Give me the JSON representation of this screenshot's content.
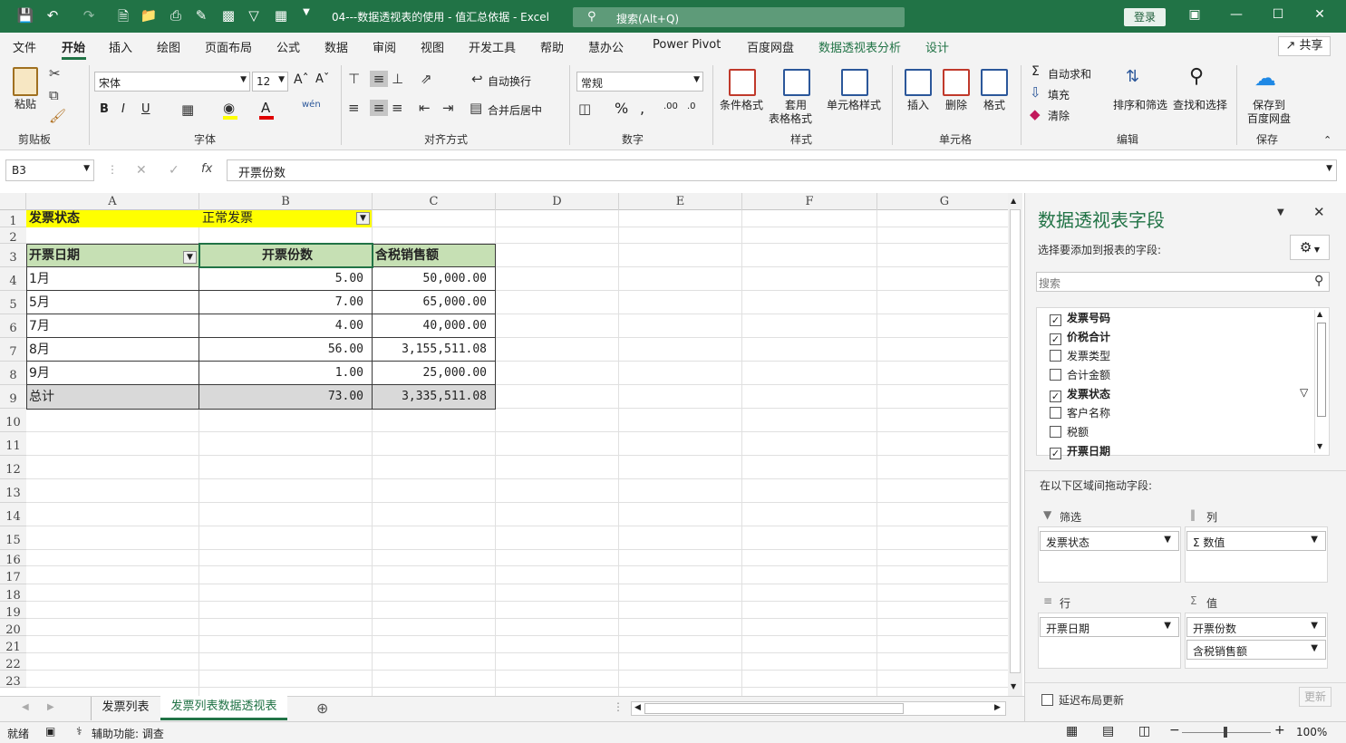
{
  "title_bar": {
    "doc_title": "04---数据透视表的使用 - 值汇总依据 - Excel",
    "search_placeholder": "搜索(Alt+Q)",
    "login": "登录"
  },
  "menu": {
    "tabs": [
      "文件",
      "开始",
      "插入",
      "绘图",
      "页面布局",
      "公式",
      "数据",
      "审阅",
      "视图",
      "开发工具",
      "帮助",
      "慧办公",
      "Power Pivot",
      "百度网盘",
      "数据透视表分析",
      "设计"
    ],
    "active": "开始",
    "share": "共享"
  },
  "ribbon": {
    "clipboard": {
      "paste": "粘贴",
      "label": "剪贴板"
    },
    "font": {
      "name": "宋体",
      "size": "12",
      "label": "字体",
      "bold": "B",
      "italic": "I",
      "underline": "U"
    },
    "align": {
      "wrap": "自动换行",
      "merge": "合并后居中",
      "label": "对齐方式"
    },
    "number": {
      "format": "常规",
      "label": "数字"
    },
    "styles": {
      "cond": "条件格式",
      "table1": "套用",
      "table2": "表格格式",
      "cell": "单元格样式",
      "label": "样式"
    },
    "cells": {
      "insert": "插入",
      "delete": "删除",
      "format": "格式",
      "label": "单元格"
    },
    "edit": {
      "autosum": "自动求和",
      "fill": "填充",
      "clear": "清除",
      "sort": "排序和筛选",
      "find": "查找和选择",
      "label": "编辑"
    },
    "save": {
      "line1": "保存到",
      "line2": "百度网盘",
      "label": "保存"
    }
  },
  "formula": {
    "namebox": "B3",
    "content": "开票份数"
  },
  "columns": [
    "A",
    "B",
    "C",
    "D",
    "E",
    "F",
    "G"
  ],
  "rows": [
    "1",
    "2",
    "3",
    "4",
    "5",
    "6",
    "7",
    "8",
    "9",
    "10",
    "11",
    "12",
    "13",
    "14",
    "15",
    "16",
    "17",
    "18",
    "19",
    "20",
    "21",
    "22",
    "23"
  ],
  "pivot": {
    "filter_label": "发票状态",
    "filter_value": "正常发票",
    "headers": [
      "开票日期",
      "开票份数",
      "含税销售额"
    ],
    "data": [
      [
        "1月",
        "5.00",
        "50,000.00"
      ],
      [
        "5月",
        "7.00",
        "65,000.00"
      ],
      [
        "7月",
        "4.00",
        "40,000.00"
      ],
      [
        "8月",
        "56.00",
        "3,155,511.08"
      ],
      [
        "9月",
        "1.00",
        "25,000.00"
      ]
    ],
    "total": [
      "总计",
      "73.00",
      "3,335,511.08"
    ]
  },
  "sheets": {
    "tabs": [
      "发票列表",
      "发票列表数据透视表"
    ],
    "active": "发票列表数据透视表"
  },
  "status": {
    "ready": "就绪",
    "accessibility": "辅助功能: 调查",
    "zoom": "100%"
  },
  "field_pane": {
    "title": "数据透视表字段",
    "subtitle": "选择要添加到报表的字段:",
    "search_placeholder": "搜索",
    "fields": [
      {
        "name": "发票号码",
        "checked": true
      },
      {
        "name": "价税合计",
        "checked": true
      },
      {
        "name": "发票类型",
        "checked": false
      },
      {
        "name": "合计金额",
        "checked": false
      },
      {
        "name": "发票状态",
        "checked": true
      },
      {
        "name": "客户名称",
        "checked": false
      },
      {
        "name": "税额",
        "checked": false
      },
      {
        "name": "开票日期",
        "checked": true
      }
    ],
    "drag_hint": "在以下区域间拖动字段:",
    "areas": {
      "filter": "筛选",
      "columns": "列",
      "rows": "行",
      "values": "值"
    },
    "filter_items": [
      "发票状态"
    ],
    "column_items": [
      "Σ 数值"
    ],
    "row_items": [
      "开票日期"
    ],
    "value_items": [
      "开票份数",
      "含税销售额"
    ],
    "defer": "延迟布局更新",
    "update": "更新"
  }
}
